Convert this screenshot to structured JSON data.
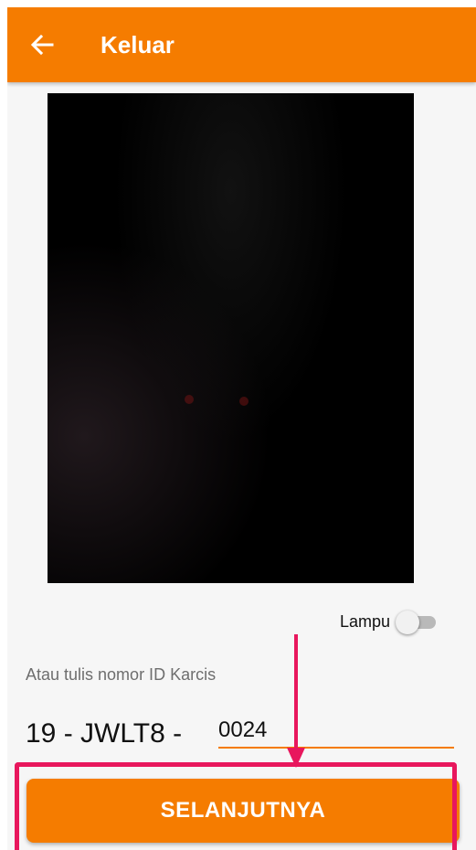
{
  "header": {
    "title": "Keluar",
    "back_icon": "arrow-left-icon",
    "color": "#f57c00"
  },
  "camera_preview": {
    "background": "#000000"
  },
  "lamp": {
    "label": "Lampu",
    "on": false
  },
  "ticket": {
    "hint": "Atau tulis nomor ID Karcis",
    "prefix": "19 - JWLT8 -",
    "value": "0024"
  },
  "actions": {
    "next_label": "SELANJUTNYA"
  },
  "annotation": {
    "highlight_color": "#e8175d",
    "arrow_icon": "arrow-down-icon"
  }
}
